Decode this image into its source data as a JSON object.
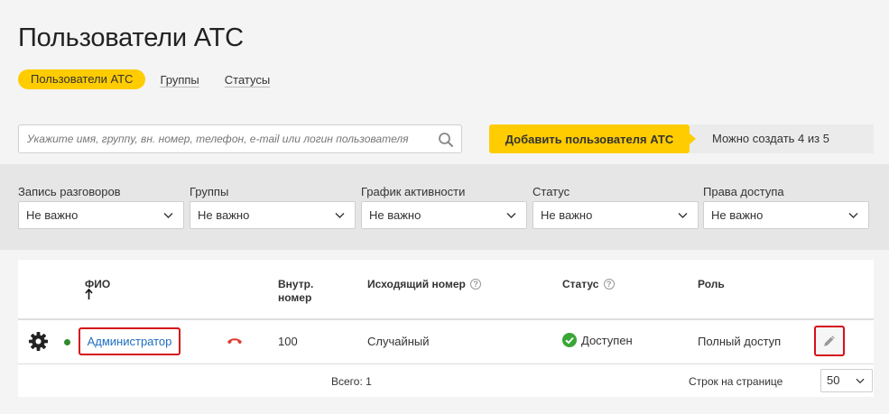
{
  "page": {
    "title": "Пользователи АТС"
  },
  "tabs": [
    {
      "label": "Пользователи АТС",
      "active": true
    },
    {
      "label": "Группы",
      "active": false
    },
    {
      "label": "Статусы",
      "active": false
    }
  ],
  "search": {
    "placeholder": "Укажите имя, группу, вн. номер, телефон, e-mail или логин пользователя",
    "value": ""
  },
  "add_button": {
    "label": "Добавить пользователя АТС"
  },
  "quota": {
    "text": "Можно создать 4 из 5"
  },
  "filters": [
    {
      "label": "Запись разговоров",
      "value": "Не важно"
    },
    {
      "label": "Группы",
      "value": "Не важно"
    },
    {
      "label": "График активности",
      "value": "Не важно"
    },
    {
      "label": "Статус",
      "value": "Не важно"
    },
    {
      "label": "Права доступа",
      "value": "Не важно"
    }
  ],
  "table": {
    "columns": {
      "name": "ФИО",
      "ext_line1": "Внутр.",
      "ext_line2": "номер",
      "outgoing": "Исходящий номер",
      "status": "Статус",
      "role": "Роль",
      "help_glyph": "?"
    },
    "rows": [
      {
        "name": "Администратор",
        "ext": "100",
        "outgoing": "Случайный",
        "status": "Доступен",
        "role": "Полный доступ",
        "online": true
      }
    ],
    "total": "Всего: 1",
    "rows_per_page_label": "Строк на странице",
    "rows_per_page": "50"
  },
  "colors": {
    "accent": "#ffcc00",
    "highlight": "#d4111a",
    "link": "#1e6fbf",
    "online": "#2e8b2e",
    "available": "#3aa635",
    "hangup": "#e03b2e"
  },
  "icons": [
    "search-icon",
    "chevron-down-icon",
    "gear-icon",
    "phone-hangup-icon",
    "check-circle-icon",
    "pencil-icon",
    "sort-arrow-up-icon",
    "help-icon"
  ]
}
